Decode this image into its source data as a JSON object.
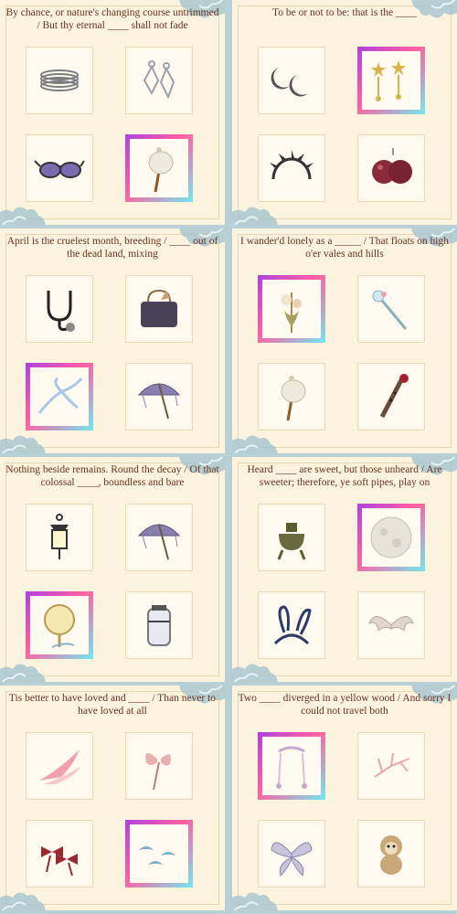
{
  "panels": [
    {
      "prompt": "By chance, or nature's changing course untrimmed / But thy eternal ____ shall not fade",
      "items": [
        {
          "icon": "bangles-icon",
          "selected": false
        },
        {
          "icon": "earrings-icon",
          "selected": false
        },
        {
          "icon": "sunglasses-icon",
          "selected": false
        },
        {
          "icon": "hairpin-icon",
          "selected": true
        }
      ]
    },
    {
      "prompt": "To be or not to be: that is the ____",
      "items": [
        {
          "icon": "crescent-earrings-icon",
          "selected": false
        },
        {
          "icon": "star-earrings-icon",
          "selected": true
        },
        {
          "icon": "spiked-headband-icon",
          "selected": false
        },
        {
          "icon": "ornament-earrings-icon",
          "selected": false
        }
      ]
    },
    {
      "prompt": "April is the cruelest month, breeding / ____ out of the dead land, mixing",
      "items": [
        {
          "icon": "stethoscope-icon",
          "selected": false
        },
        {
          "icon": "handbag-icon",
          "selected": false
        },
        {
          "icon": "ribbon-icon",
          "selected": true
        },
        {
          "icon": "parasol-icon",
          "selected": false
        }
      ]
    },
    {
      "prompt": "I wander'd lonely as a _____ / That floats on high o'er vales and hills",
      "items": [
        {
          "icon": "floral-hairpin-icon",
          "selected": true
        },
        {
          "icon": "wand-icon",
          "selected": false
        },
        {
          "icon": "hairpin-icon",
          "selected": false
        },
        {
          "icon": "flute-icon",
          "selected": false
        }
      ]
    },
    {
      "prompt": "Nothing beside remains. Round the decay / Of that colossal ____, boundless and bare",
      "items": [
        {
          "icon": "lantern-icon",
          "selected": false
        },
        {
          "icon": "parasol-icon",
          "selected": false
        },
        {
          "icon": "hand-mirror-icon",
          "selected": true
        },
        {
          "icon": "canister-icon",
          "selected": false
        }
      ]
    },
    {
      "prompt": "Heard ____ are sweet, but those unheard / Are sweeter; therefore, ye soft pipes, play on",
      "items": [
        {
          "icon": "censer-icon",
          "selected": false
        },
        {
          "icon": "moon-icon",
          "selected": true
        },
        {
          "icon": "bunny-ears-icon",
          "selected": false
        },
        {
          "icon": "wings-icon",
          "selected": false
        }
      ]
    },
    {
      "prompt": "Tis better to have loved and ____ / Than never to have loved at all",
      "items": [
        {
          "icon": "feather-wing-icon",
          "selected": false
        },
        {
          "icon": "butterfly-hairpin-icon",
          "selected": false
        },
        {
          "icon": "bows-icon",
          "selected": false
        },
        {
          "icon": "birds-icon",
          "selected": true
        }
      ]
    },
    {
      "prompt": "Two ____ diverged in a yellow wood / And sorry I could not travel both",
      "items": [
        {
          "icon": "tassel-headpiece-icon",
          "selected": true
        },
        {
          "icon": "coral-branch-icon",
          "selected": false
        },
        {
          "icon": "fairy-wings-icon",
          "selected": false
        },
        {
          "icon": "monkey-icon",
          "selected": false
        }
      ]
    }
  ]
}
